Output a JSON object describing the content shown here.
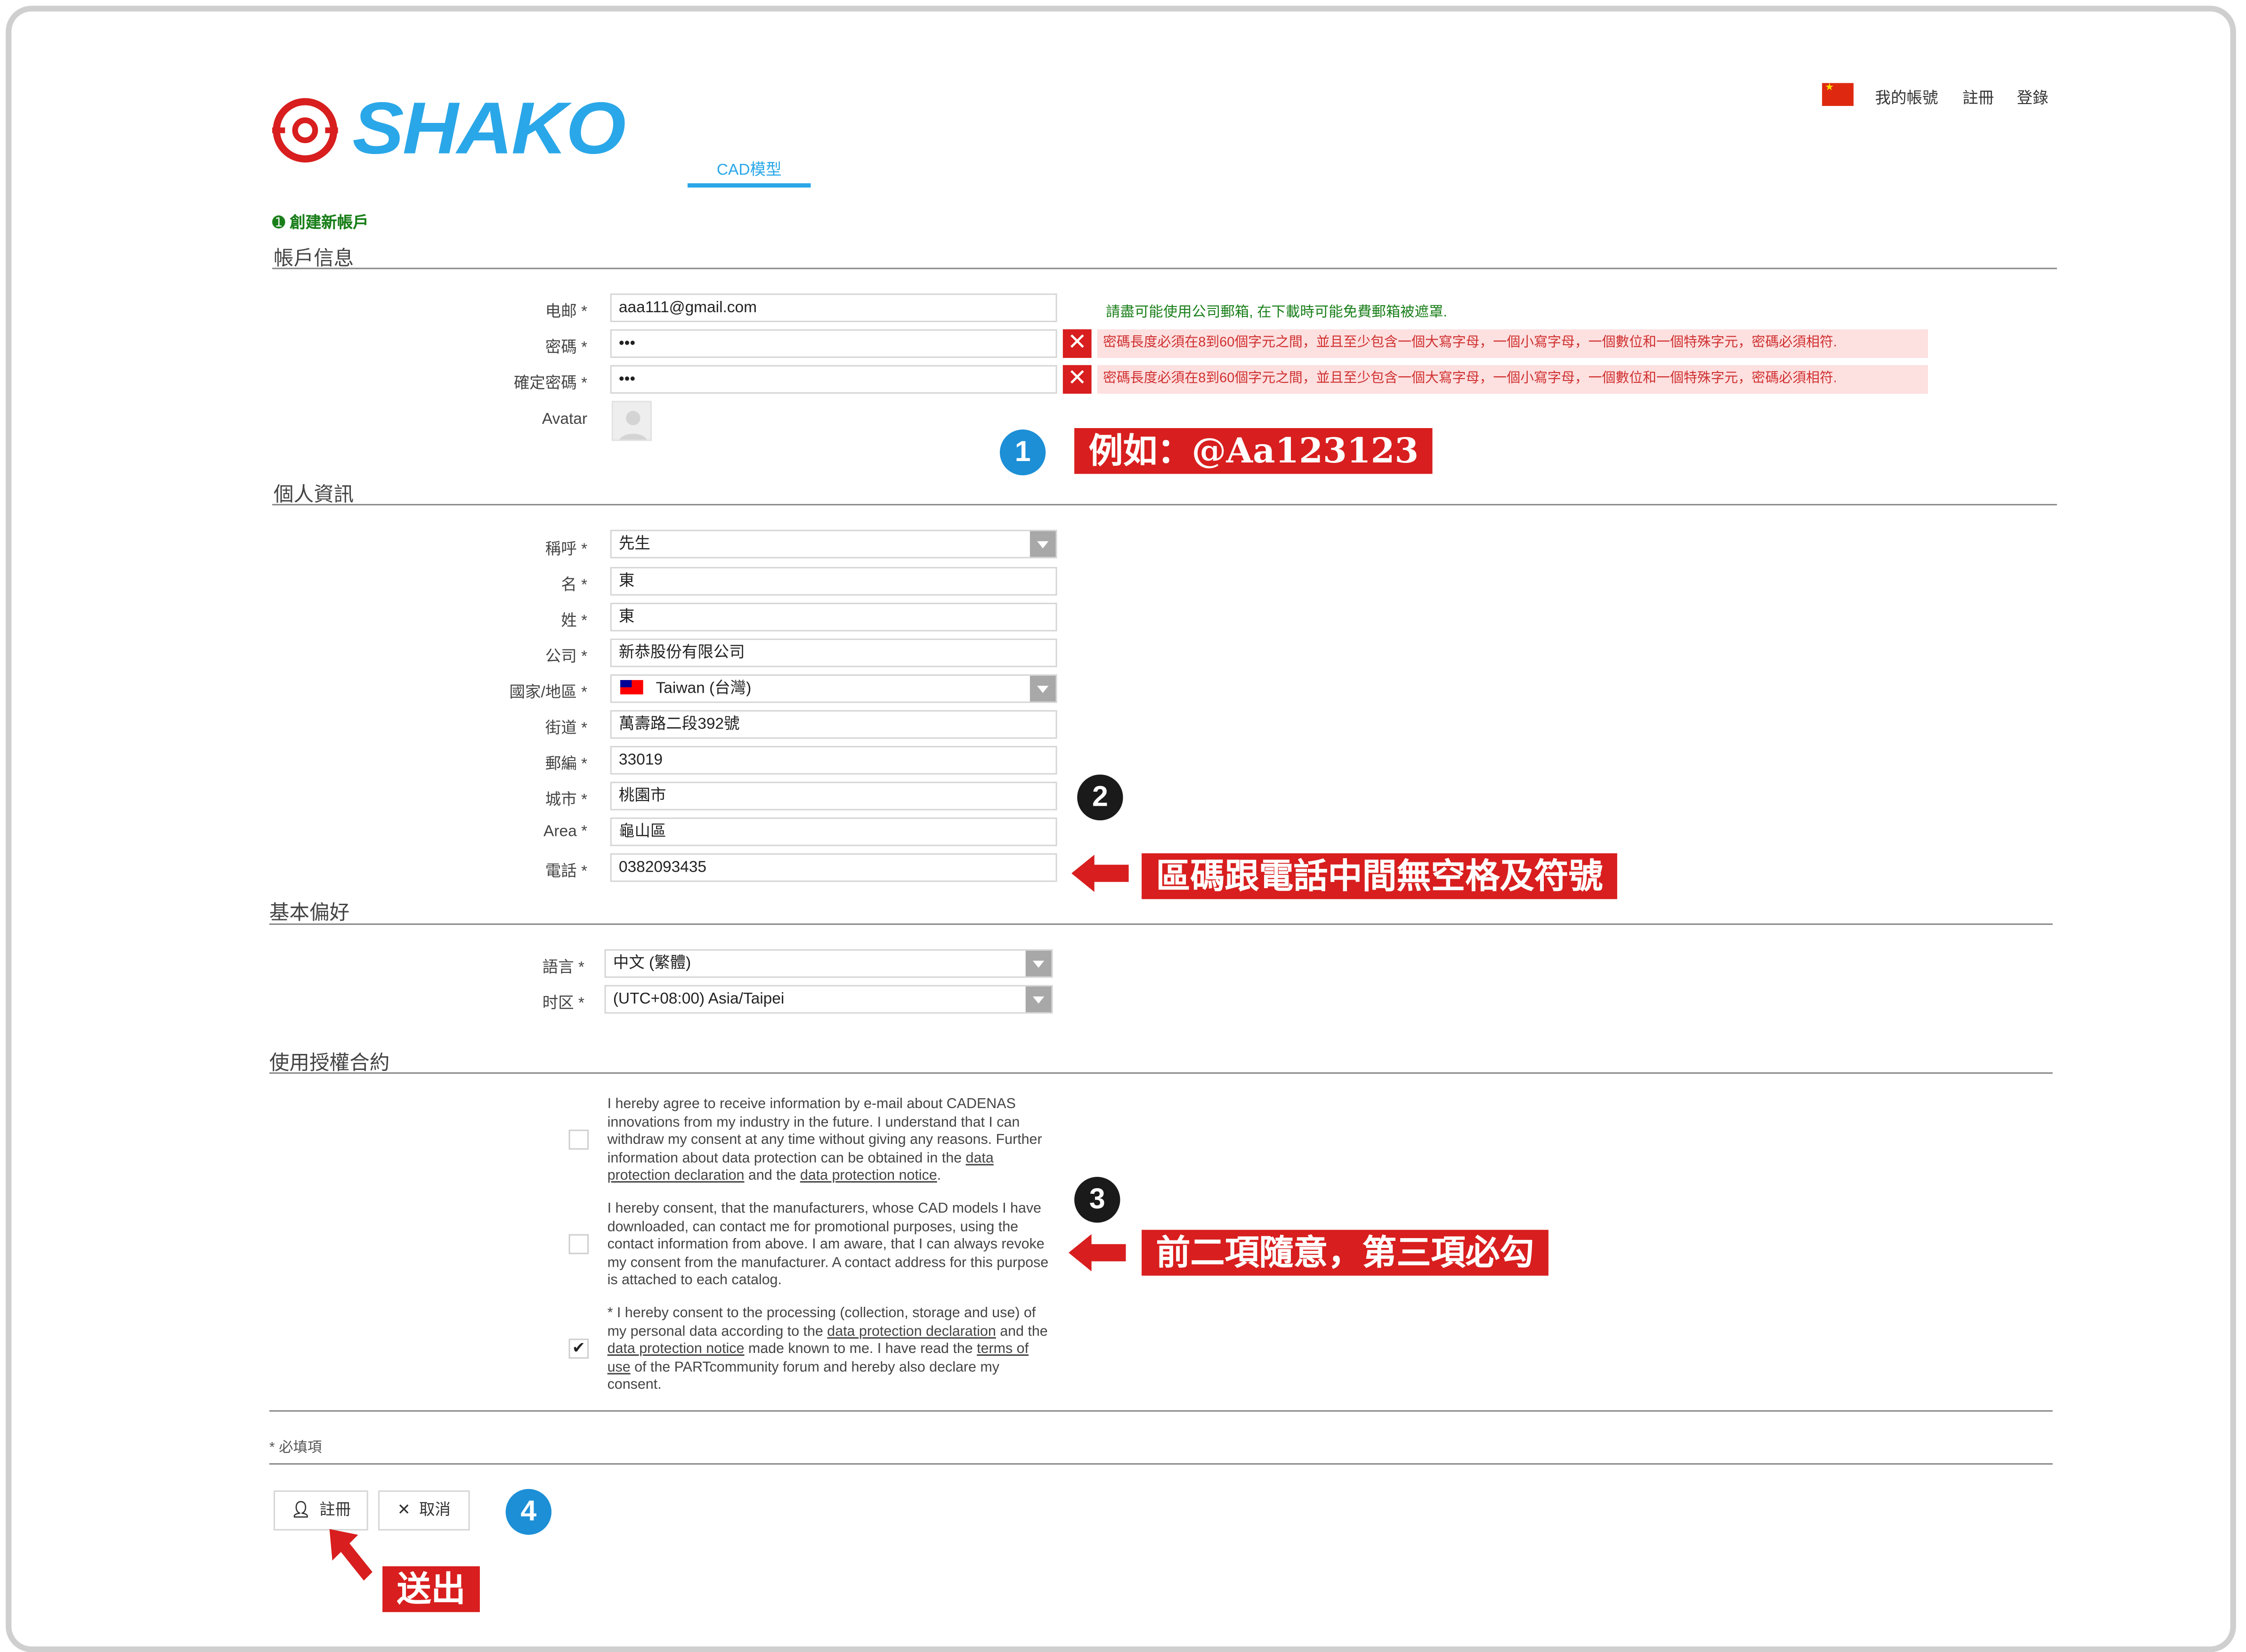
{
  "header": {
    "logo_text": "SHAKO",
    "tab": "CAD模型",
    "top_links": [
      "我的帳號",
      "註冊",
      "登錄"
    ]
  },
  "create_account": "創建新帳戶",
  "sections": {
    "account": "帳戶信息",
    "personal": "個人資訊",
    "preferences": "基本偏好",
    "license": "使用授權合約"
  },
  "account": {
    "email_label": "电邮 *",
    "email_value": "aaa111@gmail.com",
    "email_hint": "請盡可能使用公司郵箱, 在下載時可能免費郵箱被遮罩.",
    "password_label": "密碼 *",
    "password_value": "•••",
    "password_error": "密碼長度必須在8到60個字元之間，並且至少包含一個大寫字母，一個小寫字母，一個數位和一個特殊字元，密碼必須相符.",
    "confirm_label": "確定密碼 *",
    "confirm_value": "•••",
    "confirm_error": "密碼長度必須在8到60個字元之間，並且至少包含一個大寫字母，一個小寫字母，一個數位和一個特殊字元，密碼必須相符.",
    "avatar_label": "Avatar"
  },
  "personal": {
    "salutation_label": "稱呼 *",
    "salutation_value": "先生",
    "first_label": "名 *",
    "first_value": "東",
    "last_label": "姓 *",
    "last_value": "東",
    "company_label": "公司 *",
    "company_value": "新恭股份有限公司",
    "country_label": "國家/地區 *",
    "country_value": "Taiwan (台灣)",
    "street_label": "街道 *",
    "street_value": "萬壽路二段392號",
    "zip_label": "郵編 *",
    "zip_value": "33019",
    "city_label": "城市 *",
    "city_value": "桃園市",
    "area_label": "Area *",
    "area_value": "龜山區",
    "phone_label": "電話 *",
    "phone_value": "0382093435"
  },
  "preferences": {
    "language_label": "語言 *",
    "language_value": "中文 (繁體)",
    "timezone_label": "时区 *",
    "timezone_value": "(UTC+08:00) Asia/Taipei"
  },
  "consents": [
    {
      "checked": false,
      "parts": [
        "I hereby agree to receive information by e-mail about CADENAS innovations from my industry in the future. I understand that I can withdraw my consent at any time without giving any reasons. Further information about data protection can be obtained in the ",
        "data protection declaration",
        " and the ",
        "data protection notice",
        "."
      ]
    },
    {
      "checked": false,
      "text": "I hereby consent, that the manufacturers, whose CAD models I have downloaded, can contact me for promotional purposes, using the contact information from above. I am aware, that I can always revoke my consent from the manufacturer. A contact address for this purpose is attached to each catalog."
    },
    {
      "checked": true,
      "parts": [
        "* I hereby consent to the processing (collection, storage and use) of my personal data according to the ",
        "data protection declaration",
        " and the ",
        "data protection notice",
        " made known to me. I have read the ",
        "terms of use",
        " of the PARTcommunity forum and hereby also declare my consent."
      ]
    }
  ],
  "required_note": "* 必填項",
  "buttons": {
    "register": "註冊",
    "cancel": "取消"
  },
  "annotations": {
    "badge1": "1",
    "note1": "例如：@Aa123123",
    "badge2": "2",
    "note2": "區碼跟電話中間無空格及符號",
    "badge3": "3",
    "note3": "前二項隨意，第三項必勾",
    "badge4": "4",
    "note4": "送出"
  },
  "colors": {
    "brand": "#2aa7e8",
    "annotation_red": "#d81e1e",
    "badge_blue": "#1c8fd6",
    "error_bg": "#fde0e0"
  }
}
